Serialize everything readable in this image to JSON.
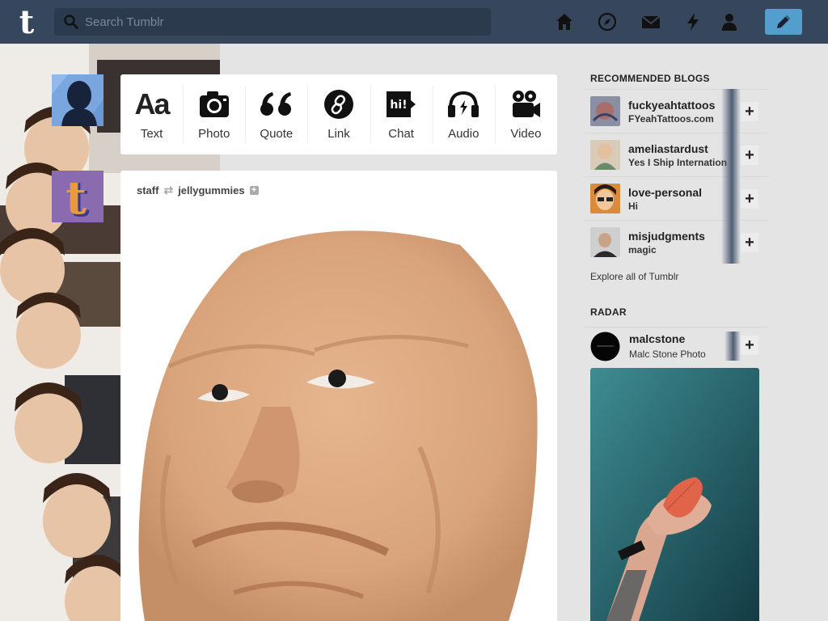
{
  "search": {
    "placeholder": "Search Tumblr"
  },
  "nav": {
    "icons": [
      "home-icon",
      "explore-icon",
      "inbox-icon",
      "activity-icon",
      "account-icon",
      "compose-icon"
    ],
    "accent": "#529ecc",
    "bar_color": "#36465d"
  },
  "post_types": [
    {
      "label": "Text",
      "glyph": "Aa"
    },
    {
      "label": "Photo"
    },
    {
      "label": "Quote"
    },
    {
      "label": "Link"
    },
    {
      "label": "Chat",
      "glyph": "hi!"
    },
    {
      "label": "Audio"
    },
    {
      "label": "Video"
    }
  ],
  "post": {
    "author": "staff",
    "reblogged_from": "jellygummies"
  },
  "recommended": {
    "heading": "RECOMMENDED BLOGS",
    "blogs": [
      {
        "name": "fuckyeahtattoos",
        "title": "FYeahTattoos.com"
      },
      {
        "name": "ameliastardust",
        "title": "Yes I Ship Internation"
      },
      {
        "name": "love-personal",
        "title": "Hi"
      },
      {
        "name": "misjudgments",
        "title": "magic"
      }
    ],
    "explore": "Explore all of Tumblr"
  },
  "radar": {
    "heading": "RADAR",
    "blog": {
      "name": "malcstone",
      "title": "Malc Stone Photo"
    }
  }
}
